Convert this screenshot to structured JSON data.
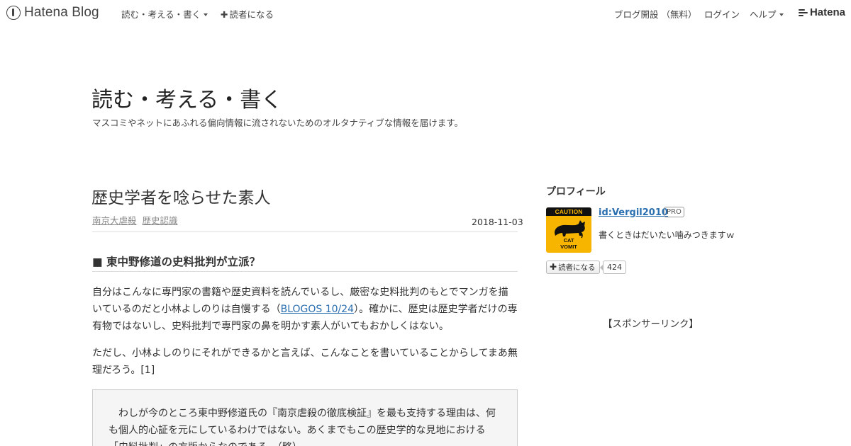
{
  "navbar": {
    "logo_text": "Hatena Blog",
    "blog_menu_label": "読む・考える・書く",
    "subscribe_label": "読者になる",
    "create_blog_label": "ブログ開設 （無料）",
    "login_label": "ログイン",
    "help_label": "ヘルプ",
    "hatena_label": "Hatena"
  },
  "blog": {
    "title": "読む・考える・書く",
    "description": "マスコミやネットにあふれる偏向情報に流されないためのオルタナティブな情報を届けます。"
  },
  "article": {
    "title": "歴史学者を唸らせた素人",
    "categories": [
      "南京大虐殺",
      "歴史認識"
    ],
    "date": "2018-11-03",
    "section_heading": "■ 東中野修道の史料批判が立派？",
    "para1_before_link": "自分はこんなに専門家の書籍や歴史資料を読んでいるし、厳密な史料批判のもとでマンガを描いているのだと小林よしのりは自慢する（",
    "para1_link": "BLOGOS 10/24",
    "para1_after_link": "）。確かに、歴史は歴史学者だけの専有物ではないし、史料批判で専門家の鼻を明かす素人がいてもおかしくはない。",
    "para2": "ただし、小林よしのりにそれができるかと言えば、こんなことを書いていることからしてまあ無理だろう。[1]",
    "quote": "　わしが今のところ東中野修道氏の『南京虐殺の徹底検証』を最も支持する理由は、何も個人的心証を元にしているわけではない。あくまでもこの歴史学的な見地における「史料批判」の方版からなのである。（略）"
  },
  "sidebar": {
    "profile_heading": "プロフィール",
    "avatar_caution": "CAUTION",
    "avatar_cat_line1": "CAT",
    "avatar_cat_line2": "VOMIT",
    "profile_id": "id:Vergil2010",
    "pro_badge": "PRO",
    "profile_desc": "書くときはだいたい噛みつきますｗ",
    "subscribe_label": "読者になる",
    "subscriber_count": "424",
    "sponsor_label": "【スポンサーリンク】"
  },
  "icons": {
    "logo": "hatena-blog-logo-icon",
    "plus": "plus-icon",
    "caret": "chevron-down-icon",
    "hatena_mark": "hatena-mark-icon"
  },
  "colors": {
    "link": "#2a6fb0",
    "avatar_bg": "#f7b500",
    "quote_bg": "#f5f5f5"
  }
}
